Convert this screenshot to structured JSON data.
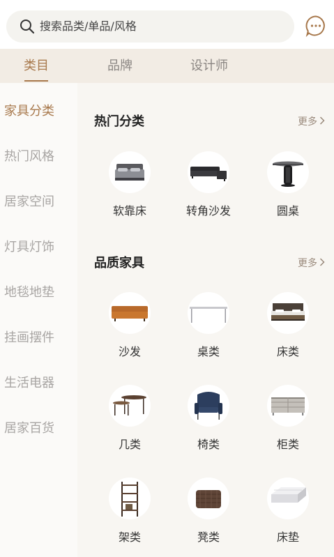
{
  "search": {
    "placeholder": "搜索品类/单品/风格",
    "icon": "search-icon",
    "message_icon": "message-icon"
  },
  "tabs": [
    {
      "label": "类目",
      "active": true
    },
    {
      "label": "品牌",
      "active": false
    },
    {
      "label": "设计师",
      "active": false
    }
  ],
  "sidebar": {
    "items": [
      {
        "label": "家具分类",
        "active": true
      },
      {
        "label": "热门风格",
        "active": false
      },
      {
        "label": "居家空间",
        "active": false
      },
      {
        "label": "灯具灯饰",
        "active": false
      },
      {
        "label": "地毯地垫",
        "active": false
      },
      {
        "label": "挂画摆件",
        "active": false
      },
      {
        "label": "生活电器",
        "active": false
      },
      {
        "label": "居家百货",
        "active": false
      }
    ]
  },
  "sections": {
    "hot": {
      "title": "热门分类",
      "more": "更多",
      "items": [
        {
          "label": "软靠床",
          "icon": "upholstered-bed-icon"
        },
        {
          "label": "转角沙发",
          "icon": "corner-sofa-icon"
        },
        {
          "label": "圆桌",
          "icon": "round-table-icon"
        }
      ]
    },
    "quality": {
      "title": "品质家具",
      "more": "更多",
      "items": [
        {
          "label": "沙发",
          "icon": "sofa-icon"
        },
        {
          "label": "桌类",
          "icon": "table-icon"
        },
        {
          "label": "床类",
          "icon": "bed-icon"
        },
        {
          "label": "几类",
          "icon": "side-table-icon"
        },
        {
          "label": "椅类",
          "icon": "armchair-icon"
        },
        {
          "label": "柜类",
          "icon": "cabinet-icon"
        },
        {
          "label": "架类",
          "icon": "shelf-icon"
        },
        {
          "label": "凳类",
          "icon": "stool-icon"
        },
        {
          "label": "床垫",
          "icon": "mattress-icon"
        }
      ]
    }
  },
  "colors": {
    "accent": "#a8794d",
    "tab_bg": "#f2ece4",
    "sidebar_bg": "#fbfaf8",
    "main_bg": "#f8f6f2"
  }
}
